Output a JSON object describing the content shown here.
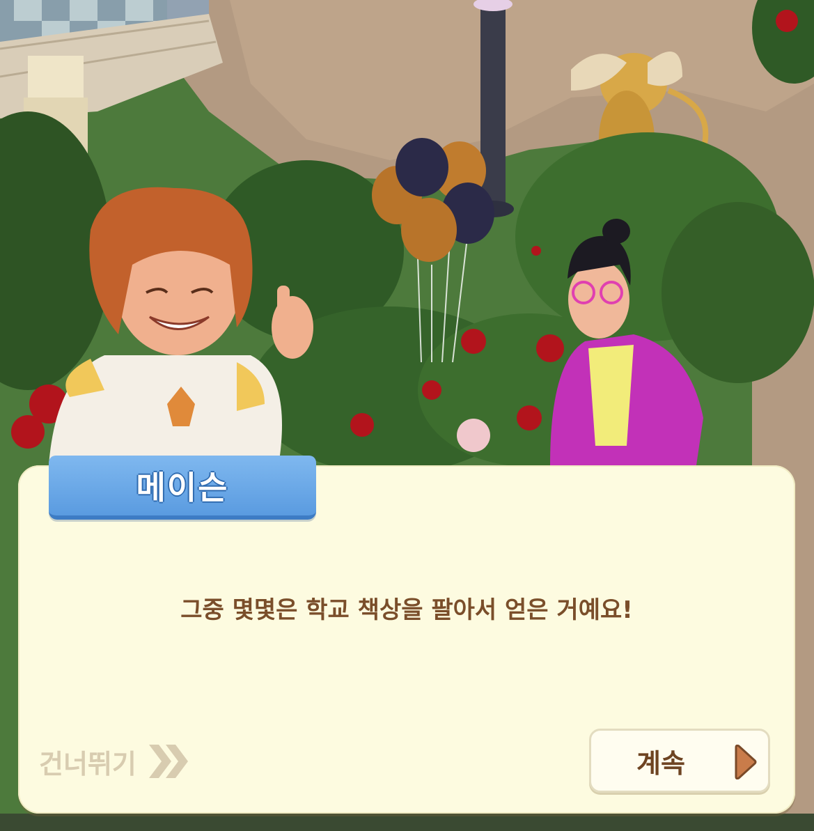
{
  "dialog": {
    "speaker_name": "메이슨",
    "text": "그중 몇몇은 학교 책상을 팔아서 얻은 거예요!"
  },
  "controls": {
    "skip_label": "건너뛰기",
    "continue_label": "계속"
  },
  "icons": {
    "skip": "double-chevron-right-icon",
    "continue": "play-triangle-icon"
  },
  "colors": {
    "dialog_background": "#fdfbe0",
    "name_tag": "#6aa8ea",
    "dialog_text": "#7a4e2a",
    "skip_text": "#d8ccb0",
    "continue_arrow": "#c97c4a"
  }
}
